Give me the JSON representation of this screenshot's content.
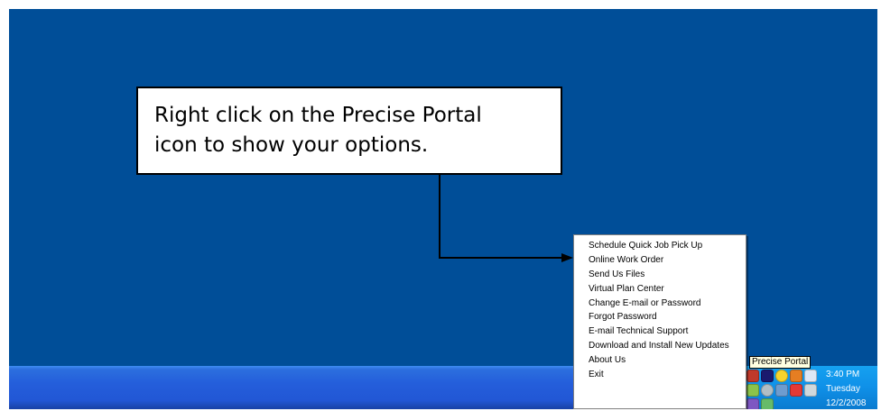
{
  "callout": {
    "line1": "Right click on the Precise Portal",
    "line2": "icon to show your options."
  },
  "context_menu": {
    "items": [
      "Schedule Quick Job Pick Up",
      "Online Work Order",
      "Send Us Files",
      "Virtual Plan Center",
      "Change E-mail or Password",
      "Forgot Password",
      "E-mail Technical Support",
      "Download and Install New Updates",
      "About Us",
      "Exit"
    ]
  },
  "tooltip": "Precise Portal",
  "tray": {
    "time": "3:40 PM",
    "day": "Tuesday",
    "date": "12/2/2008",
    "icons": [
      "precise-portal-icon",
      "security-shield-icon",
      "sun-icon",
      "chat-icon",
      "bluetooth-icon",
      "update-icon",
      "disc-icon",
      "network-icon",
      "antivirus-icon",
      "wireless-icon",
      "printer-icon",
      "speaker-icon"
    ]
  },
  "colors": {
    "desktop": "#004e98",
    "taskbar": "#245edb",
    "tray": "#0f90e8",
    "menu_bg": "#ffffff",
    "tooltip_bg": "#ffffe1"
  }
}
